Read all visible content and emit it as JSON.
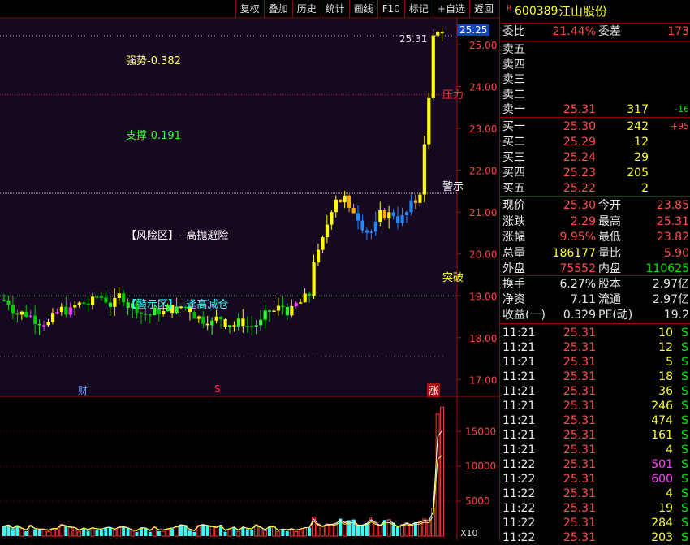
{
  "toolbar": {
    "items": [
      "复权",
      "叠加",
      "历史",
      "统计",
      "画线",
      "F10",
      "标记",
      "+自选",
      "返回"
    ]
  },
  "stock": {
    "marker": "R",
    "code": "600389",
    "name": "江山股份"
  },
  "order_ratio": {
    "label1": "委比",
    "value1": "21.44%",
    "label2": "委差",
    "value2": "173"
  },
  "sell": [
    {
      "label": "卖五",
      "price": "",
      "vol": "",
      "chg": ""
    },
    {
      "label": "卖四",
      "price": "",
      "vol": "",
      "chg": ""
    },
    {
      "label": "卖三",
      "price": "",
      "vol": "",
      "chg": ""
    },
    {
      "label": "卖二",
      "price": "",
      "vol": "",
      "chg": ""
    },
    {
      "label": "卖一",
      "price": "25.31",
      "vol": "317",
      "chg": "-16"
    }
  ],
  "buy": [
    {
      "label": "买一",
      "price": "25.30",
      "vol": "242",
      "chg": "+95"
    },
    {
      "label": "买二",
      "price": "25.29",
      "vol": "12",
      "chg": ""
    },
    {
      "label": "买三",
      "price": "25.24",
      "vol": "29",
      "chg": ""
    },
    {
      "label": "买四",
      "price": "25.23",
      "vol": "205",
      "chg": ""
    },
    {
      "label": "买五",
      "price": "25.22",
      "vol": "2",
      "chg": ""
    }
  ],
  "quote": [
    {
      "l1": "现价",
      "v1": "25.30",
      "c1": "red",
      "l2": "今开",
      "v2": "23.85",
      "c2": "red"
    },
    {
      "l1": "涨跌",
      "v1": "2.29",
      "c1": "red",
      "l2": "最高",
      "v2": "25.31",
      "c2": "red"
    },
    {
      "l1": "涨幅",
      "v1": "9.95%",
      "c1": "red",
      "l2": "最低",
      "v2": "23.82",
      "c2": "red"
    },
    {
      "l1": "总量",
      "v1": "186177",
      "c1": "yellow",
      "l2": "量比",
      "v2": "5.90",
      "c2": "red"
    },
    {
      "l1": "外盘",
      "v1": "75552",
      "c1": "red",
      "l2": "内盘",
      "v2": "110625",
      "c2": "green"
    }
  ],
  "fundamentals": [
    {
      "l1": "换手",
      "v1": "6.27%",
      "l2": "股本",
      "v2": "2.97亿"
    },
    {
      "l1": "净资",
      "v1": "7.11",
      "l2": "流通",
      "v2": "2.97亿"
    },
    {
      "l1": "收益(一)",
      "v1": "0.329",
      "l2": "PE(动)",
      "v2": "19.2"
    }
  ],
  "ticks": [
    {
      "time": "11:21",
      "price": "25.31",
      "vol": "10",
      "vcolor": "yellow",
      "side": "S"
    },
    {
      "time": "11:21",
      "price": "25.31",
      "vol": "12",
      "vcolor": "yellow",
      "side": "S"
    },
    {
      "time": "11:21",
      "price": "25.31",
      "vol": "5",
      "vcolor": "yellow",
      "side": "S"
    },
    {
      "time": "11:21",
      "price": "25.31",
      "vol": "18",
      "vcolor": "yellow",
      "side": "S"
    },
    {
      "time": "11:21",
      "price": "25.31",
      "vol": "36",
      "vcolor": "yellow",
      "side": "S"
    },
    {
      "time": "11:21",
      "price": "25.31",
      "vol": "246",
      "vcolor": "yellow",
      "side": "S"
    },
    {
      "time": "11:21",
      "price": "25.31",
      "vol": "474",
      "vcolor": "yellow",
      "side": "S"
    },
    {
      "time": "11:21",
      "price": "25.31",
      "vol": "161",
      "vcolor": "yellow",
      "side": "S"
    },
    {
      "time": "11:21",
      "price": "25.31",
      "vol": "4",
      "vcolor": "yellow",
      "side": "S"
    },
    {
      "time": "11:22",
      "price": "25.31",
      "vol": "501",
      "vcolor": "magenta",
      "side": "S"
    },
    {
      "time": "11:22",
      "price": "25.31",
      "vol": "600",
      "vcolor": "magenta",
      "side": "S"
    },
    {
      "time": "11:22",
      "price": "25.31",
      "vol": "4",
      "vcolor": "yellow",
      "side": "S"
    },
    {
      "time": "11:22",
      "price": "25.31",
      "vol": "19",
      "vcolor": "yellow",
      "side": "S"
    },
    {
      "time": "11:22",
      "price": "25.31",
      "vol": "284",
      "vcolor": "yellow",
      "side": "S"
    },
    {
      "time": "11:22",
      "price": "25.31",
      "vol": "203",
      "vcolor": "yellow",
      "side": "S"
    }
  ],
  "chart": {
    "current_price_tag": "25.25",
    "peak_label": "25.31",
    "price_ticks": [
      "25.00",
      "24.00",
      "23.00",
      "22.00",
      "21.00",
      "20.00",
      "19.00",
      "18.00",
      "17.00"
    ],
    "vol_ticks": [
      "15000",
      "10000",
      "5000"
    ],
    "vol_unit": "X10",
    "annotations": {
      "strong": "强势-0.382",
      "support": "支撑-0.191",
      "risk": "【风险区】--高抛避险",
      "warn_zone": "【警示区】--逢高减仓",
      "pressure": "压力",
      "warn": "警示",
      "breakout": "突破"
    },
    "bottom_markers": {
      "cai": "财",
      "s": "S",
      "zhang": "涨"
    }
  },
  "chart_data": {
    "type": "candlestick",
    "ylim": [
      16.6,
      25.6
    ],
    "reference_levels": {
      "pressure": 23.8,
      "warn": 21.45,
      "breakout": 19.0
    },
    "volume_ylim": [
      0,
      19000
    ],
    "volume_ticks": [
      15000,
      10000,
      5000
    ]
  }
}
